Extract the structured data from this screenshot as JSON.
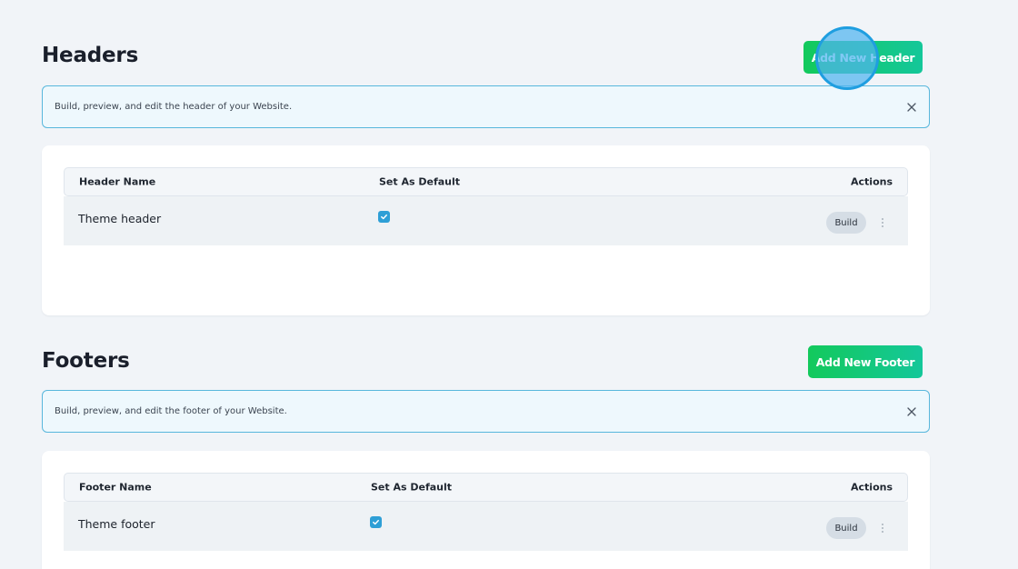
{
  "headers": {
    "title": "Headers",
    "add_button_label": "Add New Header",
    "info_text": "Build, preview, and edit the header of your Website.",
    "table": {
      "columns": [
        "Header Name",
        "Set As Default",
        "Actions"
      ],
      "rows": [
        {
          "name": "Theme header",
          "is_default": true,
          "action_label": "Build"
        }
      ]
    }
  },
  "footers": {
    "title": "Footers",
    "add_button_label": "Add New Footer",
    "info_text": "Build, preview, and edit the footer of your Website.",
    "table": {
      "columns": [
        "Footer Name",
        "Set As Default",
        "Actions"
      ],
      "rows": [
        {
          "name": "Theme footer",
          "is_default": true,
          "action_label": "Build"
        }
      ]
    }
  },
  "colors": {
    "page_background": "#f1f4f8",
    "accent_green": "#13c95c",
    "info_border": "#58b7dc",
    "checkbox_blue": "#2e9fd6"
  },
  "icons": {
    "close": "close-icon",
    "checkbox": "check-icon",
    "more": "more-vertical-icon"
  }
}
